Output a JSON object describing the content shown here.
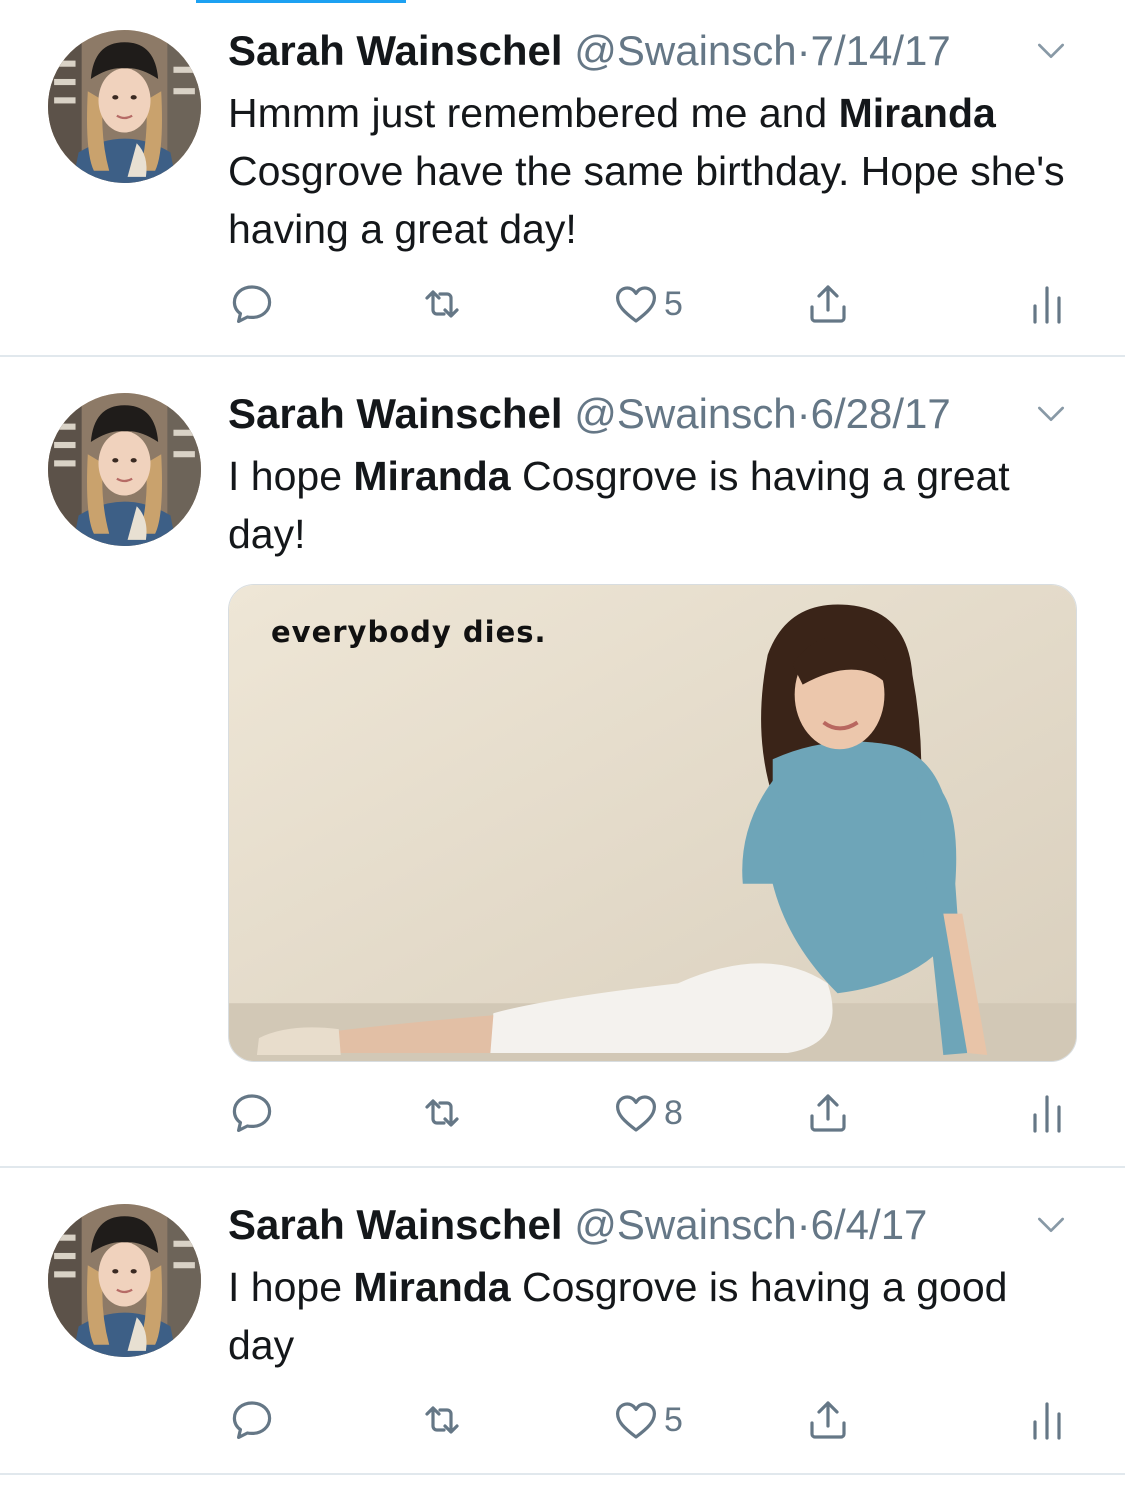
{
  "colors": {
    "accent": "#1da1f2",
    "text": "#14171a",
    "muted": "#657786",
    "divider": "#e1e8ed"
  },
  "tweets": [
    {
      "name": "Sarah Wainschel",
      "handle": "@Swainsch",
      "separator": "·",
      "date": "7/14/17",
      "text_before": "Hmmm just remembered me and ",
      "text_bold": "Miranda",
      "text_after": " Cosgrove have the same birthday. Hope she's having a great day!",
      "likes": "5"
    },
    {
      "name": "Sarah Wainschel",
      "handle": "@Swainsch",
      "separator": "·",
      "date": "6/28/17",
      "text_before": "I hope ",
      "text_bold": "Miranda",
      "text_after": " Cosgrove is having a great day!",
      "likes": "8",
      "media_caption": "everybody dies."
    },
    {
      "name": "Sarah Wainschel",
      "handle": "@Swainsch",
      "separator": "·",
      "date": "6/4/17",
      "text_before": "I hope ",
      "text_bold": "Miranda",
      "text_after": " Cosgrove is having a good day",
      "likes": "5"
    }
  ],
  "icons": [
    "reply-icon",
    "retweet-icon",
    "like-icon",
    "share-icon",
    "analytics-icon",
    "chevron-down-icon"
  ]
}
